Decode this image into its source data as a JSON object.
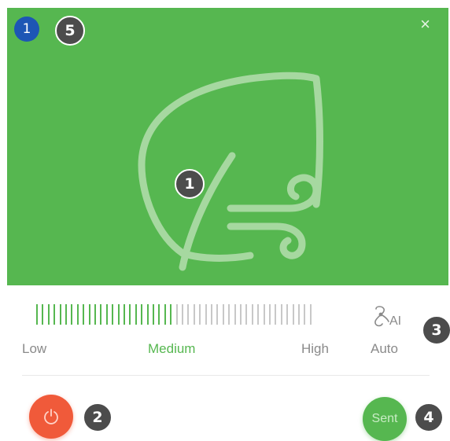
{
  "badges": {
    "mode_indicator": "1",
    "callout_five": "5",
    "callout_one": "1",
    "callout_two": "2",
    "callout_three": "3",
    "callout_four": "4"
  },
  "header": {
    "close_icon": "close-icon",
    "close_glyph": "×"
  },
  "hero": {
    "icon": "eco-leaf-wind-icon",
    "background": "#56b750"
  },
  "fan_speed": {
    "labels": {
      "low": "Low",
      "medium": "Medium",
      "high": "High",
      "auto": "Auto"
    },
    "selected": "Medium",
    "total_ticks": 48,
    "active_ticks": 24,
    "active_color": "#56b750",
    "inactive_color": "#c8c8c8",
    "auto_icon": "fan-ai-icon",
    "auto_icon_text": "AI"
  },
  "controls": {
    "power_icon": "power-icon",
    "power_color": "#f05a3a",
    "sent_label": "Sent",
    "sent_color": "#56b750"
  }
}
